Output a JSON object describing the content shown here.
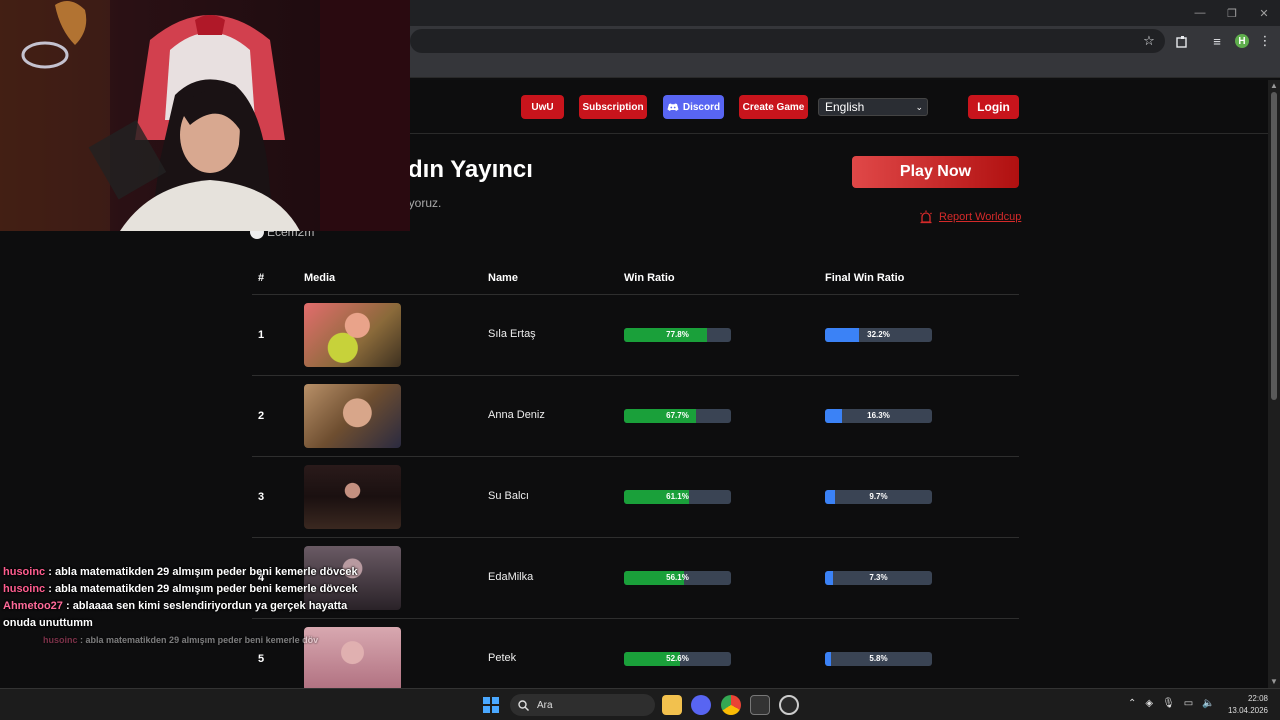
{
  "browser": {
    "window_controls": [
      "—",
      "❐",
      "✕"
    ],
    "toolbar_icons": [
      "star-icon",
      "extensions-icon",
      "media-icon"
    ],
    "profile_initial": "H"
  },
  "nav": {
    "uwu": "UwU",
    "subscription": "Subscription",
    "discord": "Discord",
    "create_game": "Create Game",
    "language": "English",
    "login": "Login"
  },
  "hero": {
    "title": "dın Yayıncı",
    "subtitle": "çiyoruz.",
    "streamer": "Ecem2m",
    "play_now": "Play Now",
    "report": "Report Worldcup"
  },
  "table": {
    "headers": [
      "#",
      "Media",
      "Name",
      "Win Ratio",
      "Final Win Ratio"
    ],
    "rows": [
      {
        "rank": "1",
        "name": "Sıla Ertaş",
        "win_label": "77.8%",
        "win": 0.778,
        "final_label": "32.2%",
        "final": 0.322
      },
      {
        "rank": "2",
        "name": "Anna Deniz",
        "win_label": "67.7%",
        "win": 0.677,
        "final_label": "16.3%",
        "final": 0.163
      },
      {
        "rank": "3",
        "name": "Su Balcı",
        "win_label": "61.1%",
        "win": 0.611,
        "final_label": "9.7%",
        "final": 0.097
      },
      {
        "rank": "4",
        "name": "EdaMilka",
        "win_label": "56.1%",
        "win": 0.561,
        "final_label": "7.3%",
        "final": 0.073
      },
      {
        "rank": "5",
        "name": "Petek",
        "win_label": "52.6%",
        "win": 0.526,
        "final_label": "5.8%",
        "final": 0.058
      }
    ]
  },
  "chat": [
    {
      "user": "husoinc",
      "text": ": abla matematikden 29 almışım peder beni kemerle dövcek"
    },
    {
      "user": "husoinc",
      "text": ": abla matematikden 29 almışım peder beni kemerle dövcek"
    },
    {
      "user": "Ahmetoo27",
      "text": ": ablaaaa sen kimi seslendiriyordun ya gerçek hayatta onuda unuttumm"
    },
    {
      "user": "husoinc",
      "text": ": abla matematikden 29 almışım peder beni kemerle döv"
    }
  ],
  "taskbar": {
    "search_label": "Ara",
    "time": "22:08",
    "date": "13.04.2026"
  }
}
